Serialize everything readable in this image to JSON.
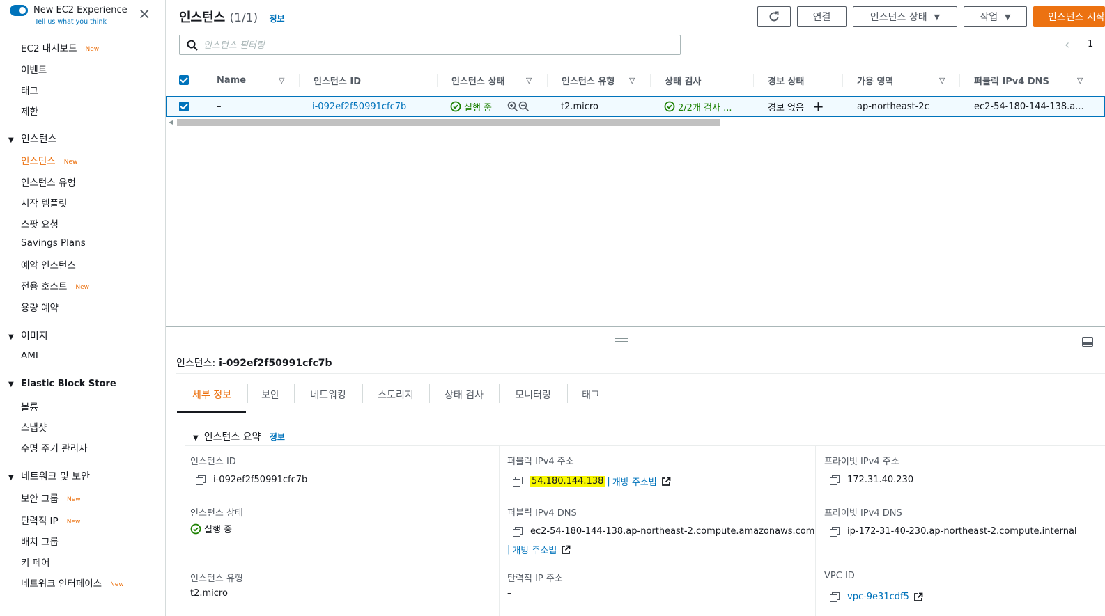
{
  "sidebar": {
    "experience_title": "New EC2 Experience",
    "experience_sub": "Tell us what you think",
    "new_badge": "New",
    "top_items": [
      {
        "label": "EC2 대시보드",
        "new": true
      },
      {
        "label": "이벤트",
        "new": false
      },
      {
        "label": "태그",
        "new": false
      },
      {
        "label": "제한",
        "new": false
      }
    ],
    "sections": {
      "instances": {
        "title": "인스턴스",
        "items": [
          {
            "label": "인스턴스",
            "new": true,
            "active": true
          },
          {
            "label": "인스턴스 유형"
          },
          {
            "label": "시작 템플릿"
          },
          {
            "label": "스팟 요청"
          },
          {
            "label": "Savings Plans"
          },
          {
            "label": "예약 인스턴스"
          },
          {
            "label": "전용 호스트",
            "new": true
          },
          {
            "label": "용량 예약"
          }
        ]
      },
      "images": {
        "title": "이미지",
        "items": [
          {
            "label": "AMI"
          }
        ]
      },
      "ebs": {
        "title": "Elastic Block Store",
        "items": [
          {
            "label": "볼륨"
          },
          {
            "label": "스냅샷"
          },
          {
            "label": "수명 주기 관리자"
          }
        ]
      },
      "network": {
        "title": "네트워크 및 보안",
        "items": [
          {
            "label": "보안 그룹",
            "new": true
          },
          {
            "label": "탄력적 IP",
            "new": true
          },
          {
            "label": "배치 그룹"
          },
          {
            "label": "키 페어"
          },
          {
            "label": "네트워크 인터페이스",
            "new": true
          }
        ]
      }
    }
  },
  "header": {
    "title": "인스턴스",
    "count": "(1/1)",
    "info": "정보",
    "connect": "연결",
    "instance_state": "인스턴스 상태",
    "actions": "작업",
    "launch": "인스턴스 시작",
    "search_placeholder": "인스턴스 필터링",
    "page": "1"
  },
  "table": {
    "columns": [
      "Name",
      "인스턴스 ID",
      "인스턴스 상태",
      "인스턴스 유형",
      "상태 검사",
      "경보 상태",
      "가용 영역",
      "퍼블릭 IPv4 DNS"
    ],
    "row": {
      "name": "–",
      "instance_id": "i-092ef2f50991cfc7b",
      "state": "실행 중",
      "type": "t2.micro",
      "status_check": "2/2개 검사 ...",
      "alarm": "경보 없음",
      "az": "ap-northeast-2c",
      "dns": "ec2-54-180-144-138.a..."
    }
  },
  "detail": {
    "title_prefix": "인스턴스:",
    "title_id": "i-092ef2f50991cfc7b",
    "tabs": [
      "세부 정보",
      "보안",
      "네트워킹",
      "스토리지",
      "상태 검사",
      "모니터링",
      "태그"
    ],
    "summary_title": "인스턴스 요약",
    "summary_info": "정보",
    "fields": {
      "instance_id_label": "인스턴스 ID",
      "instance_id": "i-092ef2f50991cfc7b",
      "state_label": "인스턴스 상태",
      "state": "실행 중",
      "type_label": "인스턴스 유형",
      "type": "t2.micro",
      "public_ip_label": "퍼블릭 IPv4 주소",
      "public_ip": "54.180.144.138",
      "open_address": "개방 주소법",
      "public_dns_label": "퍼블릭 IPv4 DNS",
      "public_dns": "ec2-54-180-144-138.ap-northeast-2.compute.amazonaws.com",
      "elastic_ip_label": "탄력적 IP 주소",
      "elastic_ip": "–",
      "private_ip_label": "프라이빗 IPv4 주소",
      "private_ip": "172.31.40.230",
      "private_dns_label": "프라이빗 IPv4 DNS",
      "private_dns": "ip-172-31-40-230.ap-northeast-2.compute.internal",
      "vpc_label": "VPC ID",
      "vpc": "vpc-9e31cdf5"
    }
  },
  "colors": {
    "accent": "#ec7211",
    "link": "#0073bb",
    "success": "#1d8102",
    "highlight": "#f7f700"
  }
}
